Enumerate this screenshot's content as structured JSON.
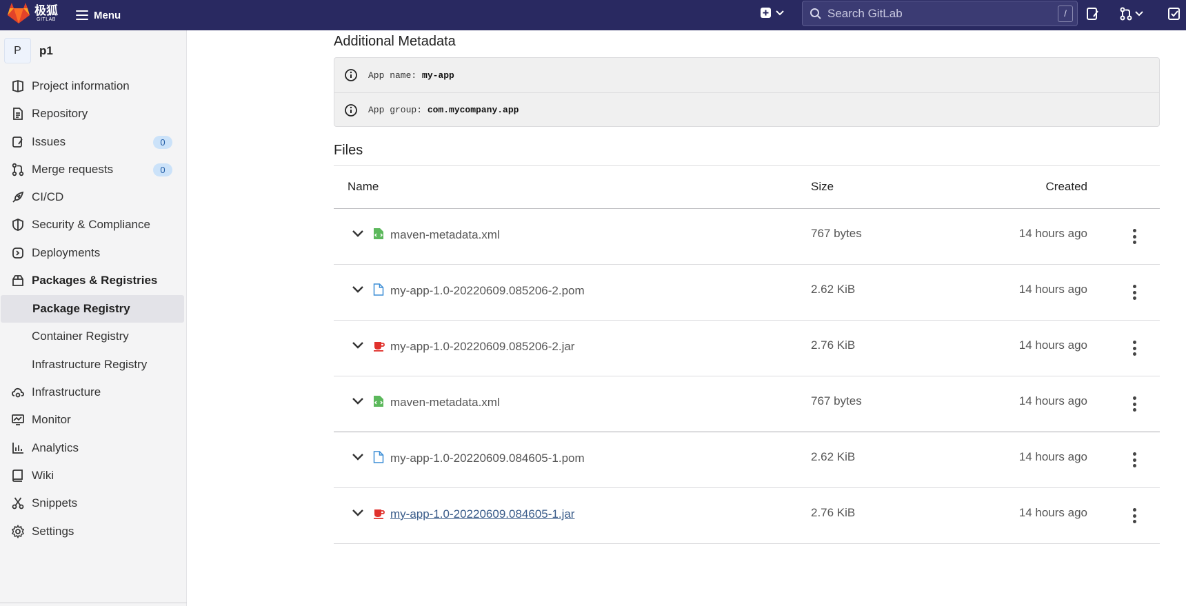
{
  "topbar": {
    "logo_text": "极狐",
    "logo_subtext": "GITLAB",
    "menu_label": "Menu",
    "search_placeholder": "Search GitLab",
    "search_shortcut": "/",
    "bg_color": "#292961"
  },
  "sidebar": {
    "project_avatar": "P",
    "project_name": "p1",
    "items": [
      {
        "label": "Project information",
        "icon": "project-icon"
      },
      {
        "label": "Repository",
        "icon": "document-icon"
      },
      {
        "label": "Issues",
        "icon": "issues-icon",
        "badge": "0"
      },
      {
        "label": "Merge requests",
        "icon": "merge-request-icon",
        "badge": "0"
      },
      {
        "label": "CI/CD",
        "icon": "rocket-icon"
      },
      {
        "label": "Security & Compliance",
        "icon": "shield-icon"
      },
      {
        "label": "Deployments",
        "icon": "deployments-icon"
      },
      {
        "label": "Packages & Registries",
        "icon": "package-icon"
      },
      {
        "label": "Package Registry",
        "sub": true,
        "active": true
      },
      {
        "label": "Container Registry",
        "sub": true
      },
      {
        "label": "Infrastructure Registry",
        "sub": true
      },
      {
        "label": "Infrastructure",
        "icon": "cloud-gear-icon"
      },
      {
        "label": "Monitor",
        "icon": "monitor-icon"
      },
      {
        "label": "Analytics",
        "icon": "chart-icon"
      },
      {
        "label": "Wiki",
        "icon": "book-icon"
      },
      {
        "label": "Snippets",
        "icon": "scissors-icon"
      },
      {
        "label": "Settings",
        "icon": "gear-icon"
      }
    ]
  },
  "main": {
    "metadata_heading": "Additional Metadata",
    "metadata": [
      {
        "label": "App name: ",
        "value": "my-app"
      },
      {
        "label": "App group: ",
        "value": "com.mycompany.app"
      }
    ],
    "files_heading": "Files",
    "columns": {
      "name": "Name",
      "size": "Size",
      "created": "Created"
    },
    "files": [
      {
        "name": "maven-metadata.xml",
        "type": "xml",
        "size": "767 bytes",
        "created": "14 hours ago"
      },
      {
        "name": "my-app-1.0-20220609.085206-2.pom",
        "type": "pom",
        "size": "2.62 KiB",
        "created": "14 hours ago"
      },
      {
        "name": "my-app-1.0-20220609.085206-2.jar",
        "type": "jar",
        "size": "2.76 KiB",
        "created": "14 hours ago"
      },
      {
        "name": "maven-metadata.xml",
        "type": "xml",
        "size": "767 bytes",
        "created": "14 hours ago"
      },
      {
        "name": "my-app-1.0-20220609.084605-1.pom",
        "type": "pom",
        "size": "2.62 KiB",
        "created": "14 hours ago"
      },
      {
        "name": "my-app-1.0-20220609.084605-1.jar",
        "type": "jar",
        "size": "2.76 KiB",
        "created": "14 hours ago",
        "hovered": true
      }
    ]
  }
}
